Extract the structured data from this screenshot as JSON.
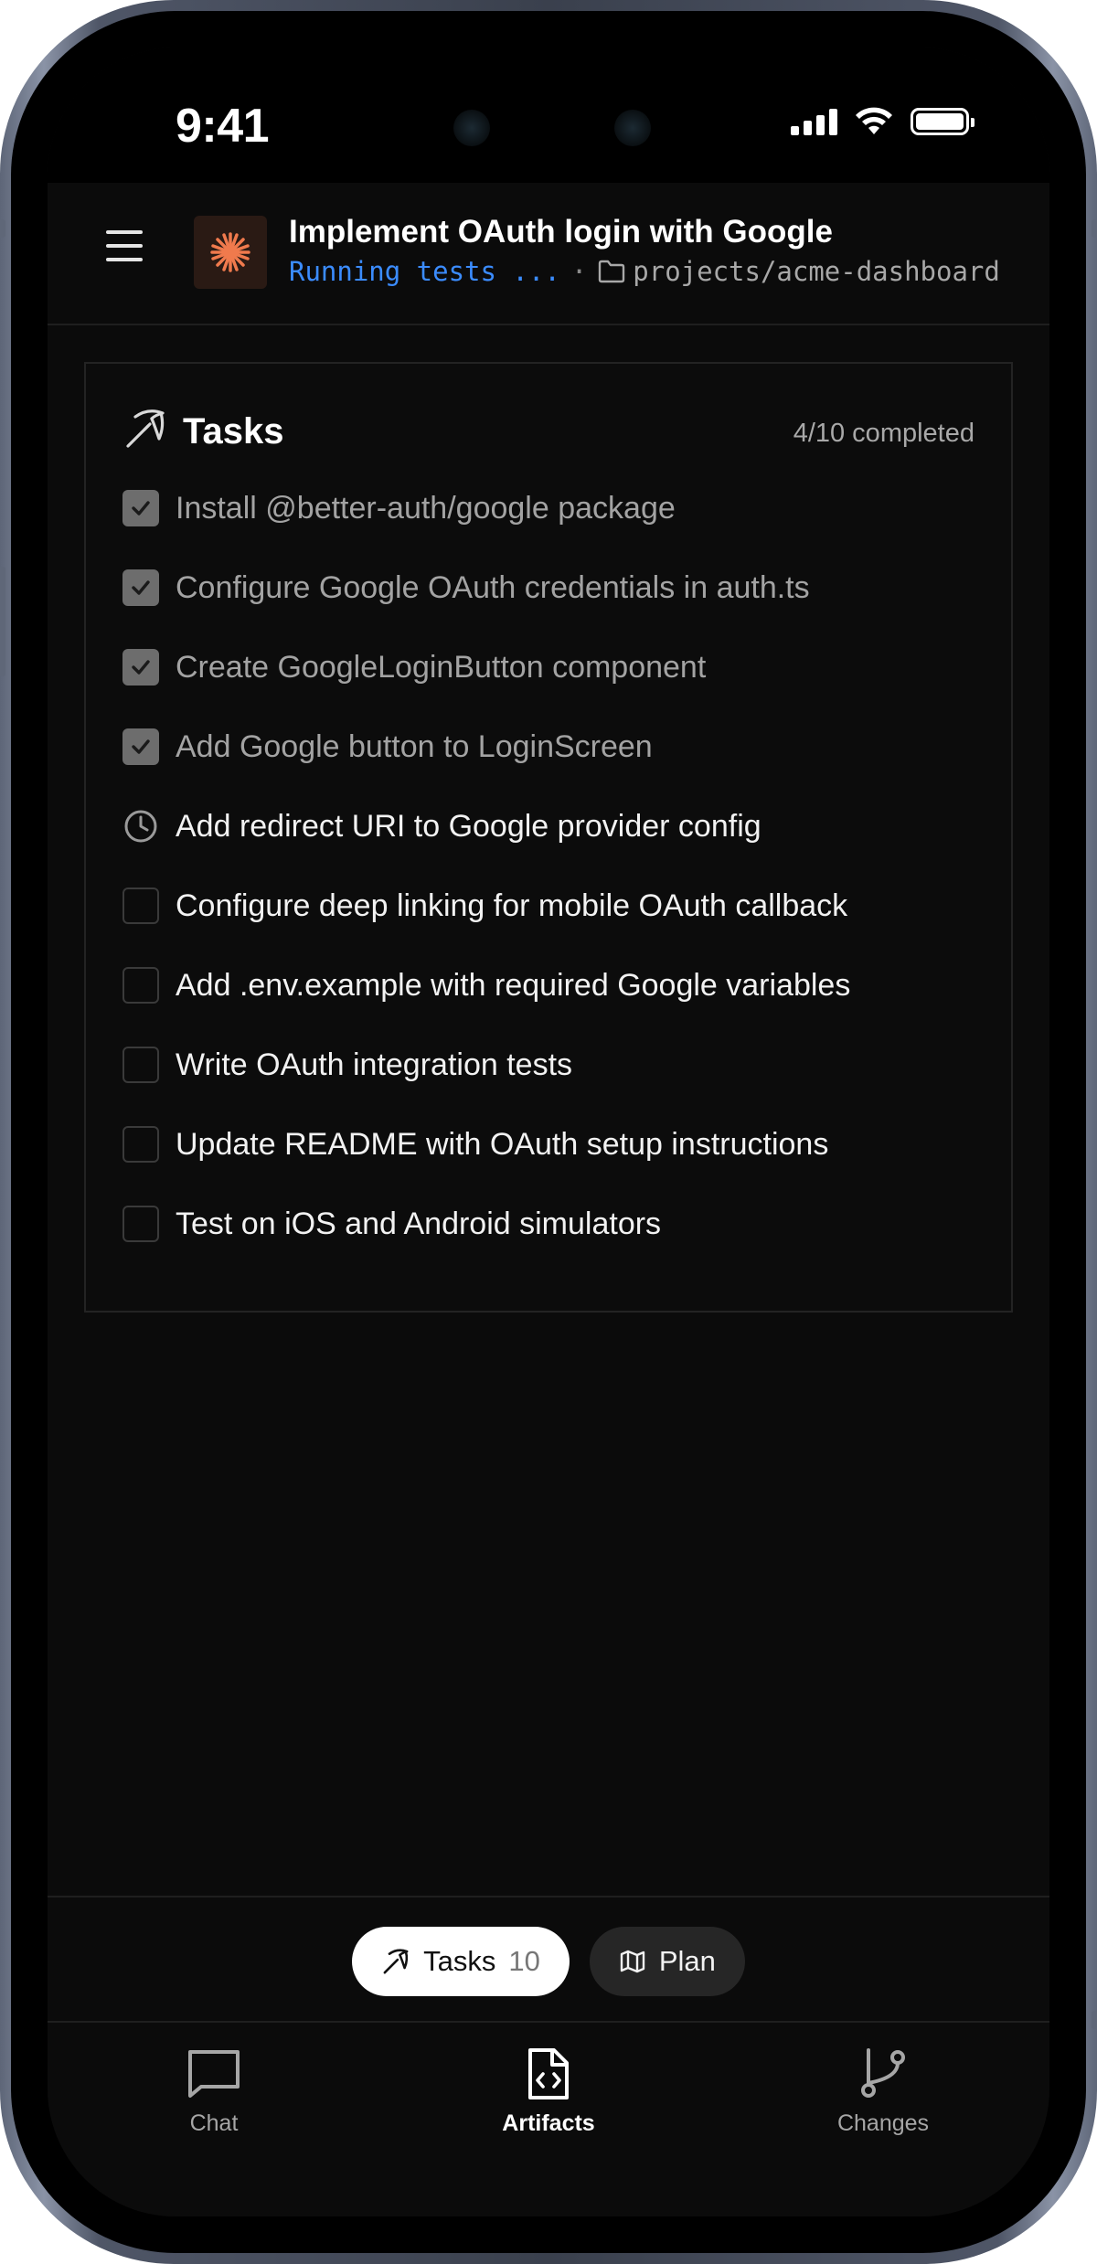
{
  "status_bar": {
    "time": "9:41"
  },
  "header": {
    "title": "Implement OAuth login with Google",
    "status": "Running tests ...",
    "separator": "·",
    "path": "projects/acme-dashboard"
  },
  "tasks_panel": {
    "title": "Tasks",
    "progress": "4/10 completed",
    "items": [
      {
        "label": "Install @better-auth/google package",
        "state": "done"
      },
      {
        "label": "Configure Google OAuth credentials in auth.ts",
        "state": "done"
      },
      {
        "label": "Create GoogleLoginButton component",
        "state": "done"
      },
      {
        "label": "Add Google button to LoginScreen",
        "state": "done"
      },
      {
        "label": "Add redirect URI to Google provider config",
        "state": "in-progress"
      },
      {
        "label": "Configure deep linking for mobile OAuth callback",
        "state": "todo"
      },
      {
        "label": "Add .env.example with required Google variables",
        "state": "todo"
      },
      {
        "label": "Write OAuth integration tests",
        "state": "todo"
      },
      {
        "label": "Update README with OAuth setup instructions",
        "state": "todo"
      },
      {
        "label": "Test on iOS and Android simulators",
        "state": "todo"
      }
    ]
  },
  "view_switcher": {
    "tasks_label": "Tasks",
    "tasks_count": "10",
    "plan_label": "Plan"
  },
  "bottom_nav": {
    "chat": "Chat",
    "artifacts": "Artifacts",
    "changes": "Changes"
  },
  "colors": {
    "accent": "#3b8cff",
    "logo_orange": "#f07a4d",
    "background": "#0b0b0b"
  }
}
